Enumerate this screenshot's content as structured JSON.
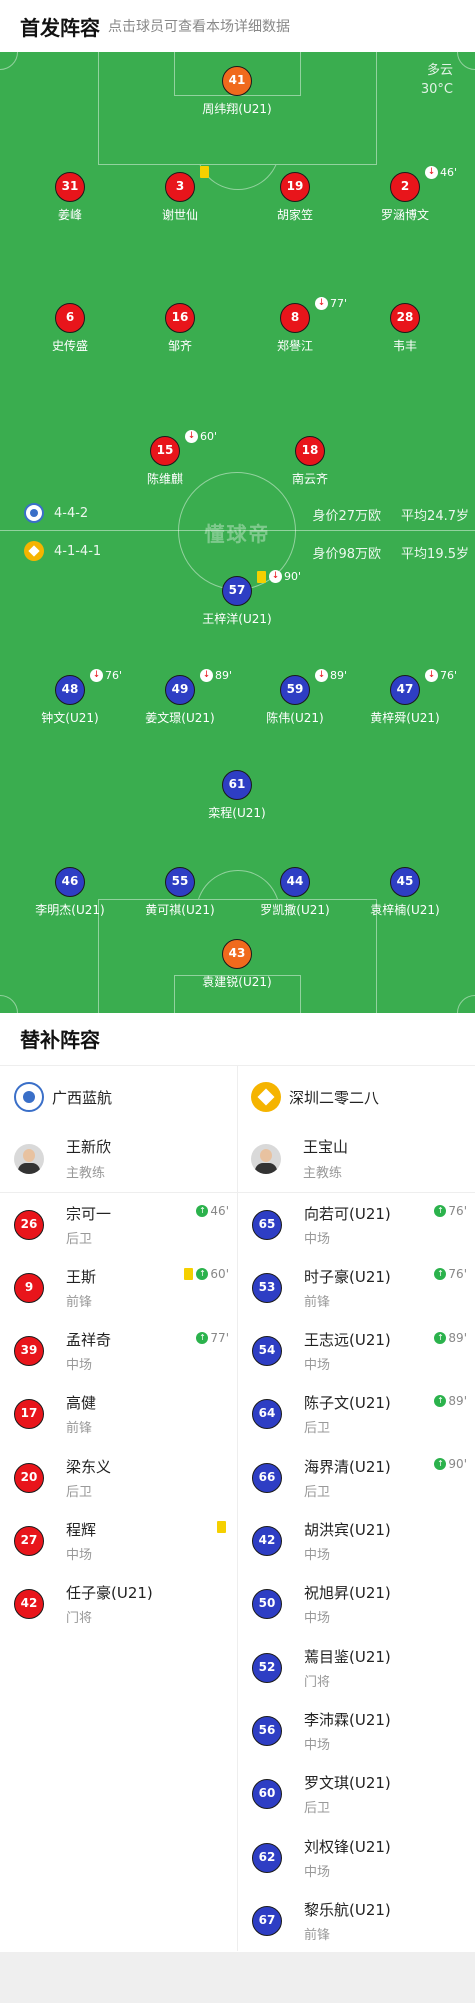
{
  "header": {
    "title": "首发阵容",
    "subtitle": "点击球员可查看本场详细数据"
  },
  "pitch": {
    "weather": "多云",
    "temperature": "30°C",
    "watermark": "懂球帝",
    "home_formation": "4-4-2",
    "home_value": "身价27万欧",
    "home_avg_age": "平均24.7岁",
    "away_formation": "4-1-4-1",
    "away_value": "身价98万欧",
    "away_avg_age": "平均19.5岁"
  },
  "home_players": [
    {
      "num": "41",
      "name": "周纬翔(U21)",
      "color": "orange"
    },
    {
      "num": "31",
      "name": "姜峰",
      "color": "red"
    },
    {
      "num": "3",
      "name": "谢世仙",
      "color": "red",
      "card": "yellow"
    },
    {
      "num": "19",
      "name": "胡家笠",
      "color": "red"
    },
    {
      "num": "2",
      "name": "罗涵博文",
      "color": "red",
      "sub_min": "46'"
    },
    {
      "num": "6",
      "name": "史传盛",
      "color": "red",
      "captain": "c"
    },
    {
      "num": "16",
      "name": "邹齐",
      "color": "red"
    },
    {
      "num": "8",
      "name": "郑譽江",
      "color": "red",
      "sub_min": "77'"
    },
    {
      "num": "28",
      "name": "韦丰",
      "color": "red"
    },
    {
      "num": "15",
      "name": "陈维麒",
      "color": "red",
      "sub_min": "60'"
    },
    {
      "num": "18",
      "name": "南云齐",
      "color": "red"
    }
  ],
  "away_players": [
    {
      "num": "57",
      "name": "王梓洋(U21)",
      "color": "blue",
      "card": "yellow",
      "sub_min": "90'",
      "goal": true
    },
    {
      "num": "48",
      "name": "钟文(U21)",
      "color": "blue",
      "sub_min": "76'"
    },
    {
      "num": "49",
      "name": "姜文璟(U21)",
      "color": "blue",
      "sub_min": "89'"
    },
    {
      "num": "59",
      "name": "陈伟(U21)",
      "color": "blue",
      "sub_min": "89'"
    },
    {
      "num": "47",
      "name": "黄梓舜(U21)",
      "color": "blue",
      "sub_min": "76'",
      "goal": true
    },
    {
      "num": "61",
      "name": "栾程(U21)",
      "color": "blue",
      "captain": "c",
      "assist": true
    },
    {
      "num": "46",
      "name": "李明杰(U21)",
      "color": "blue"
    },
    {
      "num": "55",
      "name": "黄可祺(U21)",
      "color": "blue"
    },
    {
      "num": "44",
      "name": "罗凯撒(U21)",
      "color": "blue"
    },
    {
      "num": "45",
      "name": "袁梓楠(U21)",
      "color": "blue",
      "assist": true
    },
    {
      "num": "43",
      "name": "袁建锐(U21)",
      "color": "orange"
    }
  ],
  "subs": {
    "title": "替补阵容",
    "home": {
      "team": "广西蓝航",
      "coach": {
        "name": "王新欣",
        "role": "主教练"
      },
      "players": [
        {
          "num": "26",
          "name": "宗可一",
          "pos": "后卫",
          "in": "46'"
        },
        {
          "num": "9",
          "name": "王斯",
          "pos": "前锋",
          "in": "60'",
          "card": "yellow"
        },
        {
          "num": "39",
          "name": "孟祥奇",
          "pos": "中场",
          "in": "77'"
        },
        {
          "num": "17",
          "name": "高健",
          "pos": "前锋"
        },
        {
          "num": "20",
          "name": "梁东义",
          "pos": "后卫"
        },
        {
          "num": "27",
          "name": "程辉",
          "pos": "中场",
          "card": "yellow"
        },
        {
          "num": "42",
          "name": "任子豪(U21)",
          "pos": "门将"
        }
      ]
    },
    "away": {
      "team": "深圳二零二八",
      "coach": {
        "name": "王宝山",
        "role": "主教练"
      },
      "players": [
        {
          "num": "65",
          "name": "向若可(U21)",
          "pos": "中场",
          "in": "76'"
        },
        {
          "num": "53",
          "name": "时子豪(U21)",
          "pos": "前锋",
          "in": "76'"
        },
        {
          "num": "54",
          "name": "王志远(U21)",
          "pos": "中场",
          "in": "89'"
        },
        {
          "num": "64",
          "name": "陈子文(U21)",
          "pos": "后卫",
          "in": "89'"
        },
        {
          "num": "66",
          "name": "海界清(U21)",
          "pos": "后卫",
          "in": "90'"
        },
        {
          "num": "42",
          "name": "胡洪宾(U21)",
          "pos": "中场"
        },
        {
          "num": "50",
          "name": "祝旭昇(U21)",
          "pos": "中场"
        },
        {
          "num": "52",
          "name": "蔫目鉴(U21)",
          "pos": "门将"
        },
        {
          "num": "56",
          "name": "李沛霖(U21)",
          "pos": "中场"
        },
        {
          "num": "60",
          "name": "罗文琪(U21)",
          "pos": "后卫"
        },
        {
          "num": "62",
          "name": "刘权锋(U21)",
          "pos": "中场"
        },
        {
          "num": "67",
          "name": "黎乐航(U21)",
          "pos": "前锋"
        }
      ]
    }
  }
}
